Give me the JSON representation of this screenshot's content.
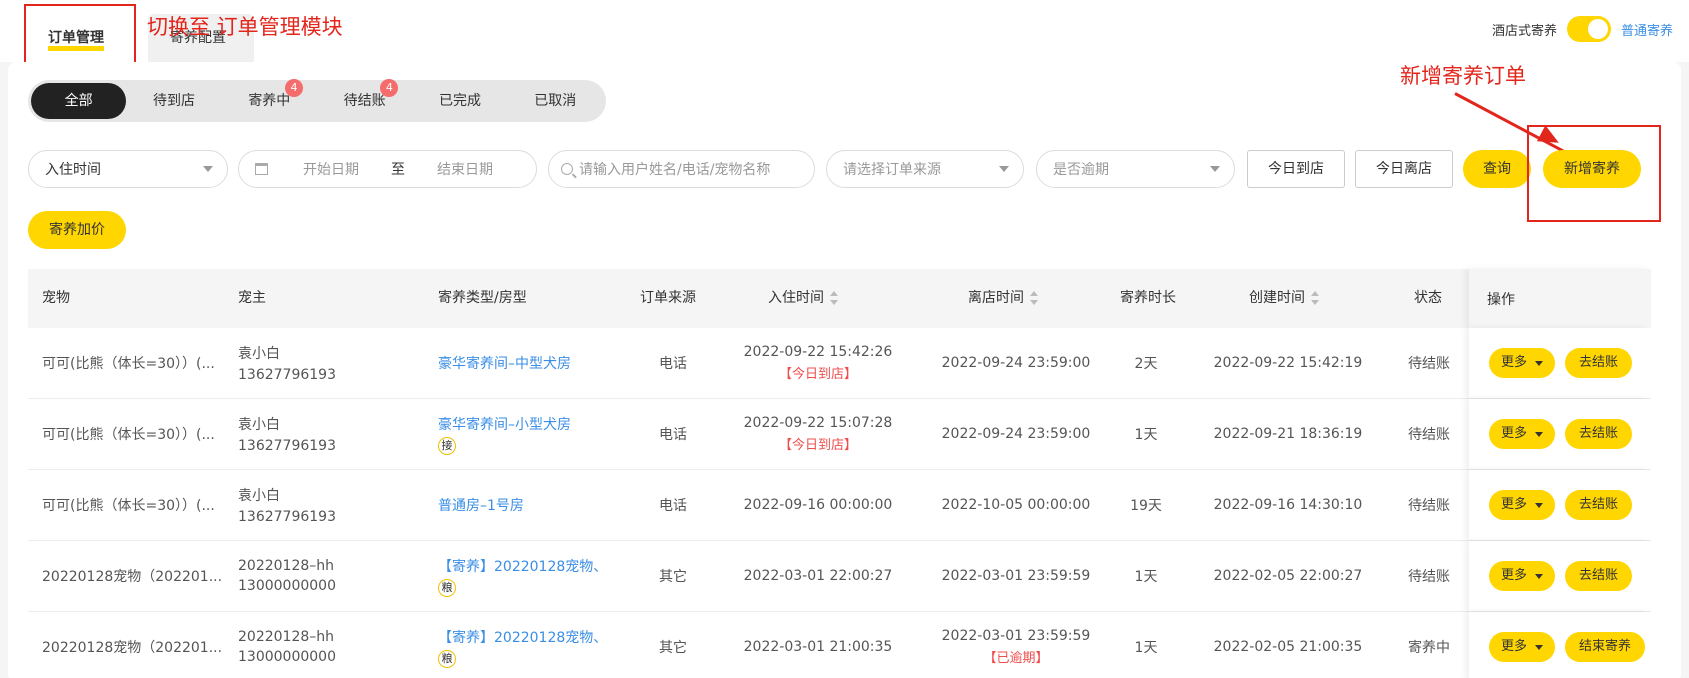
{
  "top_tabs": [
    {
      "label": "订单管理",
      "active": true
    },
    {
      "label": "寄养配置",
      "active": false
    }
  ],
  "annotations": {
    "switch_module": "切换至 订单管理模块",
    "add_order": "新增寄养订单"
  },
  "mode_switch": {
    "left_label": "酒店式寄养",
    "right_label": "普通寄养",
    "on": true
  },
  "status_tabs": [
    {
      "label": "全部",
      "active": true,
      "badge": ""
    },
    {
      "label": "待到店",
      "active": false,
      "badge": ""
    },
    {
      "label": "寄养中",
      "active": false,
      "badge": "4"
    },
    {
      "label": "待结账",
      "active": false,
      "badge": "4"
    },
    {
      "label": "已完成",
      "active": false,
      "badge": ""
    },
    {
      "label": "已取消",
      "active": false,
      "badge": ""
    }
  ],
  "filters": {
    "time_type": "入住时间",
    "start_placeholder": "开始日期",
    "range_sep": "至",
    "end_placeholder": "结束日期",
    "search_placeholder": "请输入用户姓名/电话/宠物名称",
    "source_placeholder": "请选择订单来源",
    "overdue_placeholder": "是否逾期"
  },
  "buttons": {
    "today_arrive": "今日到店",
    "today_leave": "今日离店",
    "query": "查询",
    "add_boarding": "新增寄养",
    "surcharge": "寄养加价"
  },
  "table": {
    "headers": {
      "pet": "宠物",
      "owner": "宠主",
      "room": "寄养类型/房型",
      "source": "订单来源",
      "checkin": "入住时间",
      "checkout": "离店时间",
      "duration": "寄养时长",
      "created": "创建时间",
      "status": "状态",
      "ops": "操作"
    },
    "more_label": "更多",
    "rows": [
      {
        "pet": "可可(比熊（体长=30））(...",
        "owner_name": "袁小白",
        "owner_phone": "13627796193",
        "room": "豪华寄养间–中型犬房",
        "tag": "",
        "source": "电话",
        "checkin": "2022-09-22 15:42:26",
        "checkin_note": "【今日到店】",
        "checkout": "2022-09-24 23:59:00",
        "checkout_note": "",
        "duration": "2天",
        "created": "2022-09-22 15:42:19",
        "status": "待结账",
        "action": "去结账"
      },
      {
        "pet": "可可(比熊（体长=30））(...",
        "owner_name": "袁小白",
        "owner_phone": "13627796193",
        "room": "豪华寄养间–小型犬房",
        "tag": "接",
        "source": "电话",
        "checkin": "2022-09-22 15:07:28",
        "checkin_note": "【今日到店】",
        "checkout": "2022-09-24 23:59:00",
        "checkout_note": "",
        "duration": "1天",
        "created": "2022-09-21 18:36:19",
        "status": "待结账",
        "action": "去结账"
      },
      {
        "pet": "可可(比熊（体长=30））(...",
        "owner_name": "袁小白",
        "owner_phone": "13627796193",
        "room": "普通房–1号房",
        "tag": "",
        "source": "电话",
        "checkin": "2022-09-16 00:00:00",
        "checkin_note": "",
        "checkout": "2022-10-05 00:00:00",
        "checkout_note": "",
        "duration": "19天",
        "created": "2022-09-16 14:30:10",
        "status": "待结账",
        "action": "去结账"
      },
      {
        "pet": "20220128宠物（202201...",
        "owner_name": "20220128–hh",
        "owner_phone": "13000000000",
        "room": "【寄养】20220128宠物、",
        "tag": "粮",
        "source": "其它",
        "checkin": "2022-03-01 22:00:27",
        "checkin_note": "",
        "checkout": "2022-03-01 23:59:59",
        "checkout_note": "",
        "duration": "1天",
        "created": "2022-02-05 22:00:27",
        "status": "待结账",
        "action": "去结账"
      },
      {
        "pet": "20220128宠物（202201...",
        "owner_name": "20220128–hh",
        "owner_phone": "13000000000",
        "room": "【寄养】20220128宠物、",
        "tag": "粮",
        "source": "其它",
        "checkin": "2022-03-01 21:00:35",
        "checkin_note": "",
        "checkout": "2022-03-01 23:59:59",
        "checkout_note": "【已逾期】",
        "duration": "1天",
        "created": "2022-02-05 21:00:35",
        "status": "寄养中",
        "action": "结束寄养"
      }
    ]
  }
}
